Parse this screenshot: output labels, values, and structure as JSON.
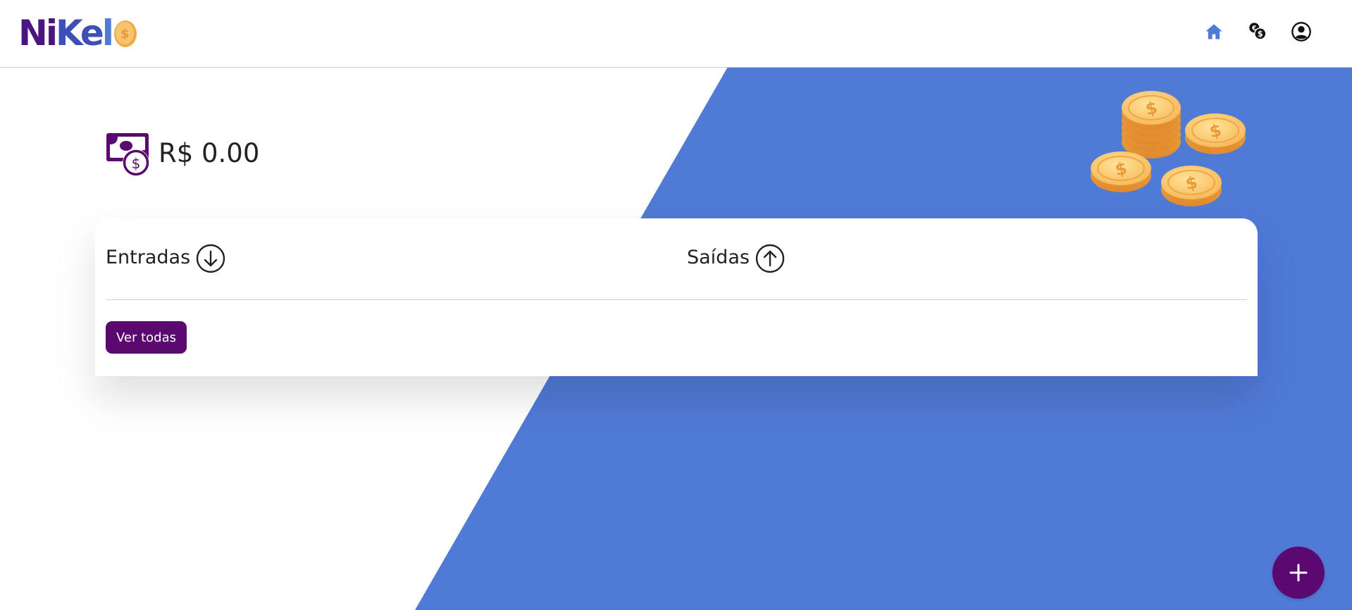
{
  "brand": {
    "logo_parts": [
      "Ni",
      "Ke",
      "l"
    ],
    "colors": {
      "purple": "#4b1580",
      "blue": "#4f7ad6",
      "accent_purple": "#5a0a6e",
      "coin": "#f5b95a"
    }
  },
  "navbar": {
    "icons": [
      "home-icon",
      "currency-exchange-icon",
      "account-circle-icon"
    ]
  },
  "balance": {
    "value": "R$ 0.00",
    "icon": "cash-dollar-icon"
  },
  "card": {
    "incoming": {
      "label": "Entradas",
      "icon": "arrow-down-circle-icon"
    },
    "outgoing": {
      "label": "Saídas",
      "icon": "arrow-up-circle-icon"
    },
    "view_all_label": "Ver todas"
  },
  "fab": {
    "label": "+"
  }
}
